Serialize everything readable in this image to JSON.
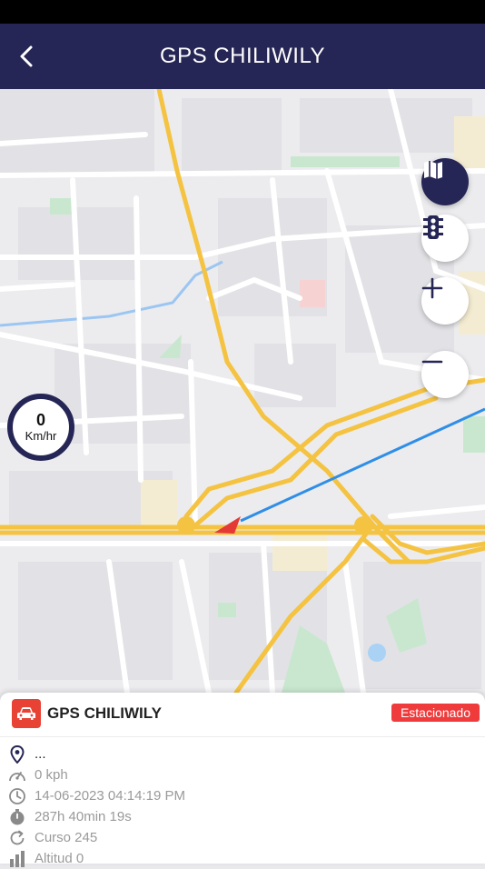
{
  "header": {
    "title": "GPS CHILIWILY"
  },
  "map": {
    "speed_value": "0",
    "speed_unit": "Km/hr"
  },
  "panel": {
    "unit_name": "GPS CHILIWILY",
    "status": "Estacionado",
    "address": "...",
    "speed": "0 kph",
    "timestamp": "14-06-2023 04:14:19 PM",
    "duration": "287h 40min 19s",
    "course": "Curso 245",
    "altitude": "Altitud 0"
  },
  "colors": {
    "navbar": "#262656",
    "status_red": "#ef3b3b",
    "route_blue": "#2f8ee6",
    "highway_yellow": "#f5c342"
  }
}
